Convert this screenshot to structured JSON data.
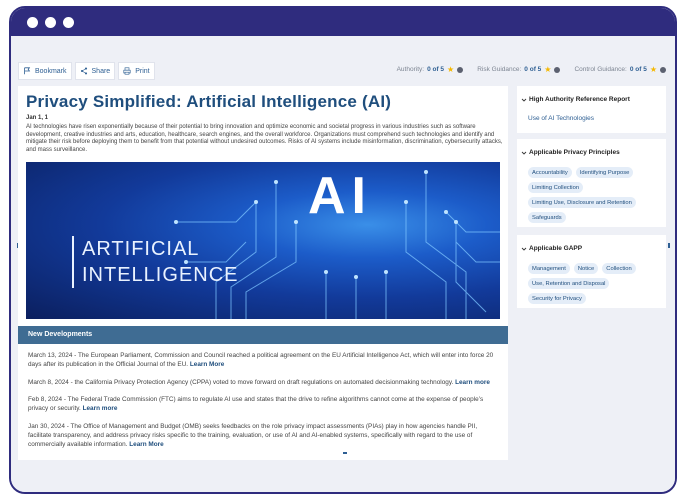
{
  "toolbar": {
    "bookmark_label": "Bookmark",
    "share_label": "Share",
    "print_label": "Print"
  },
  "ratings": [
    {
      "label": "Authority:",
      "value": "0 of 5"
    },
    {
      "label": "Risk Guidance:",
      "value": "0 of 5"
    },
    {
      "label": "Control Guidance:",
      "value": "0 of 5"
    }
  ],
  "article": {
    "title": "Privacy Simplified: Artificial Intelligence (AI)",
    "date": "Jan 1, 1",
    "body": "AI technologies have risen exponentially because of their potential to bring innovation and optimize economic and societal progress in various industries such as software development, creative industries and arts, education, healthcare, search engines, and the overall workforce. Organizations must comprehend such technologies and identify and mitigate their risk before deploying them to benefit from that potential without undesired outcomes. Risks of AI systems include misinformation, discrimination, cybersecurity attacks, and mass surveillance."
  },
  "hero": {
    "line1": "ARTIFICIAL",
    "line2": "INTELLIGENCE",
    "badge": "AI"
  },
  "developments": {
    "header": "New Developments",
    "learn_more": "Learn More",
    "learn_more_lower": "Learn more",
    "items": [
      {
        "text": "March 13, 2024 - The European Parliament, Commission and Council reached a political agreement on the EU Artificial Intelligence Act, which will enter into force 20 days after its publication in the Official Journal of the EU. "
      },
      {
        "text": "March 8, 2024 - the California Privacy Protection Agency (CPPA) voted to move forward on draft regulations on automated decisionmaking technology. "
      },
      {
        "text": "Feb 8, 2024 - The Federal Trade Commission (FTC) aims to regulate AI use and states that the drive to refine algorithms cannot come at the expense of people’s privacy or security. "
      },
      {
        "text": "Jan 30, 2024 - The Office of Management and Budget (OMB) seeks feedbacks on the role privacy impact assessments (PIAs) play in how agencies handle PII, facilitate transparency, and address privacy risks specific to the training, evaluation, or use of AI and AI-enabled systems, specifically with regard to the use of commercially available information. "
      }
    ]
  },
  "sidebar": {
    "report": {
      "title": "High Authority Reference Report",
      "link": "Use of AI Technologies"
    },
    "principles": {
      "title": "Applicable Privacy Principles",
      "chips": [
        "Accountability",
        "Identifying Purpose",
        "Limiting Collection",
        "Limiting Use, Disclosure and Retention",
        "Safeguards"
      ]
    },
    "gapp": {
      "title": "Applicable GAPP",
      "chips": [
        "Management",
        "Notice",
        "Collection",
        "Use, Retention and Disposal",
        "Security for Privacy"
      ]
    }
  },
  "colors": {
    "window_frame": "#2f2c7e",
    "accent_blue": "#1f4e7d",
    "section_header": "#3f6c93",
    "chip_bg": "#e4edf8",
    "star": "#f5b800"
  }
}
